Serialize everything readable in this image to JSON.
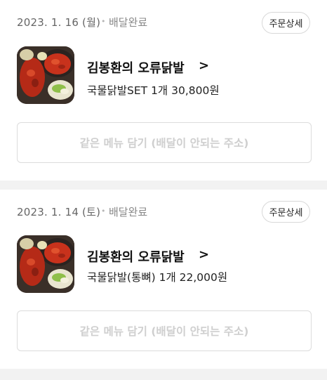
{
  "orders": [
    {
      "date": "2023. 1. 16 (월)",
      "status": "배달완료",
      "detail_label": "주문상세",
      "store": "김봉환의 오류닭발",
      "menu": "국물닭발SET 1개 30,800원",
      "reorder_label": "같은 메뉴 담기 (배달이 안되는 주소)"
    },
    {
      "date": "2023. 1. 14 (토)",
      "status": "배달완료",
      "detail_label": "주문상세",
      "store": "김봉환의 오류닭발",
      "menu": "국물닭발(통뼈) 1개 22,000원",
      "reorder_label": "같은 메뉴 담기 (배달이 안되는 주소)"
    }
  ],
  "separator": "•",
  "chevron": ">",
  "icons": {
    "chevron": "chevron-right-icon"
  }
}
